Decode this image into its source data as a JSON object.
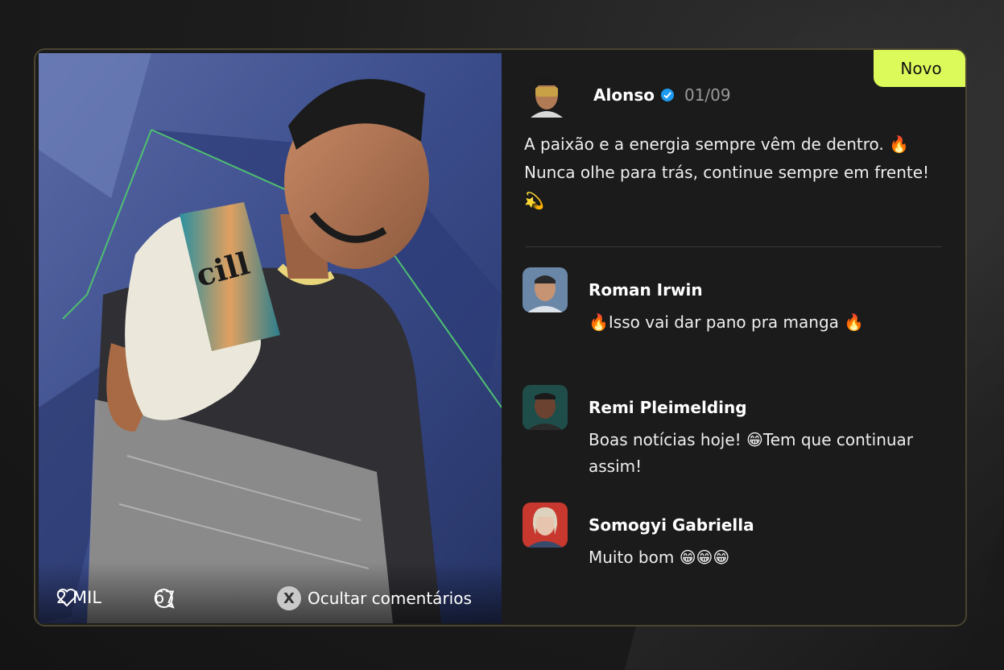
{
  "badge": "Novo",
  "post": {
    "author": "Alonso",
    "date": "01/09",
    "text": "A paixão e a energia sempre vêm de dentro. 🔥 Nunca olhe para trás, continue sempre em frente! 💫"
  },
  "stats": {
    "likes": "2 MIL",
    "comments": "67"
  },
  "hide_comments": {
    "key": "X",
    "label": "Ocultar comentários"
  },
  "comments": [
    {
      "name": "Roman Irwin",
      "text": "🔥Isso vai dar pano pra manga 🔥"
    },
    {
      "name": "Remi Pleimelding",
      "text": "Boas notícias hoje! 😁Tem que continuar assim!"
    },
    {
      "name": "Somogyi Gabriella",
      "text": "Muito bom 😁😁😁"
    }
  ],
  "colors": {
    "badge": "#dcfa5a",
    "verified": "#1d9bf0",
    "card_border": "#4a4430"
  }
}
